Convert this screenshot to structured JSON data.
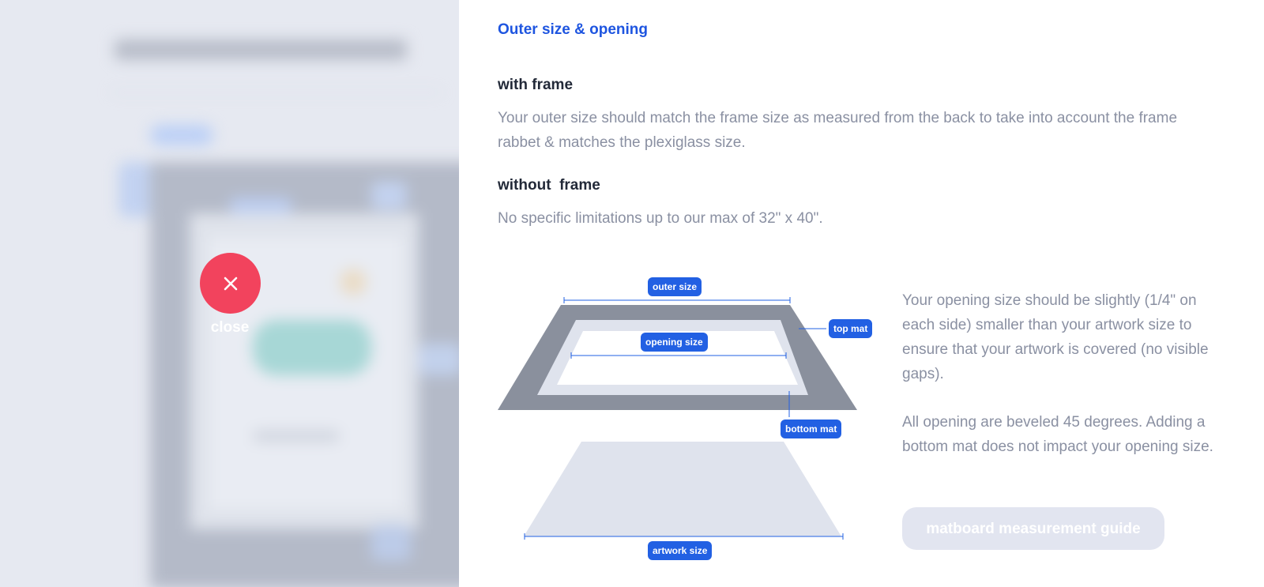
{
  "overlay": {
    "close_label": "close"
  },
  "panel": {
    "section_title": "Outer size & opening",
    "with_frame": {
      "heading": "with frame",
      "text": "Your outer size should match the frame size as measured from the back to take into account the frame rabbet & matches the plexiglass size."
    },
    "without_frame": {
      "heading": "without  frame",
      "text": "No specific limitations up to our max of 32\" x 40\"."
    },
    "diagram_labels": {
      "outer_size": "outer size",
      "top_mat": "top mat",
      "opening_size": "opening size",
      "bottom_mat": "bottom mat",
      "artwork_size": "artwork size"
    },
    "opening_note": "Your opening size should be slightly (1/4\" on each side) smaller than your artwork size to ensure that your artwork is covered (no visible gaps).",
    "bevel_note": "All opening are beveled 45 degrees. Adding a bottom mat does not impact your opening size.",
    "guide_button": "matboard measurement guide"
  },
  "colors": {
    "accent": "#1e55e0",
    "tag": "#2260e3",
    "close": "#f2435d",
    "mat_dark": "#8a909d",
    "mat_light": "#dfe3ed"
  }
}
